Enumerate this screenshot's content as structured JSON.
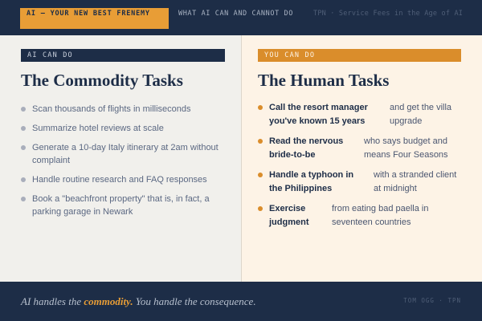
{
  "header": {
    "tabs": [
      {
        "label": "AI — YOUR NEW BEST FRENEMY"
      },
      {
        "label": "WHAT AI CAN AND CANNOT DO"
      },
      {
        "label": "TPN · Service Fees in the Age of AI"
      }
    ]
  },
  "left": {
    "label": "AI CAN DO",
    "heading": "The Commodity Tasks",
    "items": [
      "Scan thousands of flights in milliseconds",
      "Summarize hotel reviews at scale",
      "Generate a 10-day Italy itinerary at 2am without complaint",
      "Handle routine research and FAQ responses",
      "Book a \"beachfront property\" that is, in fact, a parking garage in Newark"
    ]
  },
  "right": {
    "label": "YOU CAN DO",
    "heading": "The Human Tasks",
    "items": [
      {
        "strong": "Call the resort manager you've known 15 years",
        "rest": "and get the villa upgrade"
      },
      {
        "strong": "Read the nervous bride-to-be",
        "rest": "who says budget and means Four Seasons"
      },
      {
        "strong": "Handle a typhoon in the Philippines",
        "rest": "with a stranded client at midnight"
      },
      {
        "strong": "Exercise judgment",
        "rest": "from eating bad paella in seventeen countries"
      }
    ]
  },
  "footer": {
    "tagline_pre": "AI handles the ",
    "tagline_highlight": "commodity.",
    "tagline_post": " You handle the consequence.",
    "byline": "TOM OGG · TPN"
  },
  "colors": {
    "navy": "#1d2d47",
    "accent_orange": "#e89d36",
    "label_orange": "#da8d2b",
    "left_bg": "#f1f0ec",
    "right_bg": "#fdf3e6"
  }
}
